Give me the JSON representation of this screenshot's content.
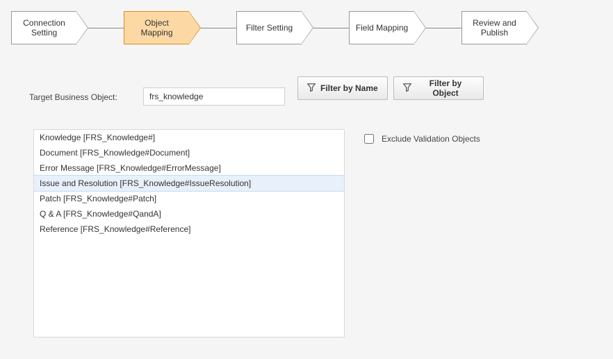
{
  "wizard": {
    "steps": [
      {
        "label": "Connection Setting",
        "active": false
      },
      {
        "label": "Object Mapping",
        "active": true
      },
      {
        "label": "Filter Setting",
        "active": false
      },
      {
        "label": "Field Mapping",
        "active": false
      },
      {
        "label": "Review and Publish",
        "active": false
      }
    ]
  },
  "controls": {
    "target_label": "Target Business Object:",
    "target_value": "frs_knowledge",
    "filter_name_label": "Filter by Name",
    "filter_object_label": "Filter by Object",
    "exclude_label": "Exclude Validation Objects",
    "exclude_checked": false
  },
  "list": {
    "items": [
      {
        "text": "Knowledge [FRS_Knowledge#]"
      },
      {
        "text": "Document [FRS_Knowledge#Document]"
      },
      {
        "text": "Error Message [FRS_Knowledge#ErrorMessage]"
      },
      {
        "text": "Issue and Resolution [FRS_Knowledge#IssueResolution]",
        "selected": true
      },
      {
        "text": "Patch [FRS_Knowledge#Patch]"
      },
      {
        "text": "Q & A [FRS_Knowledge#QandA]"
      },
      {
        "text": "Reference [FRS_Knowledge#Reference]"
      }
    ]
  }
}
